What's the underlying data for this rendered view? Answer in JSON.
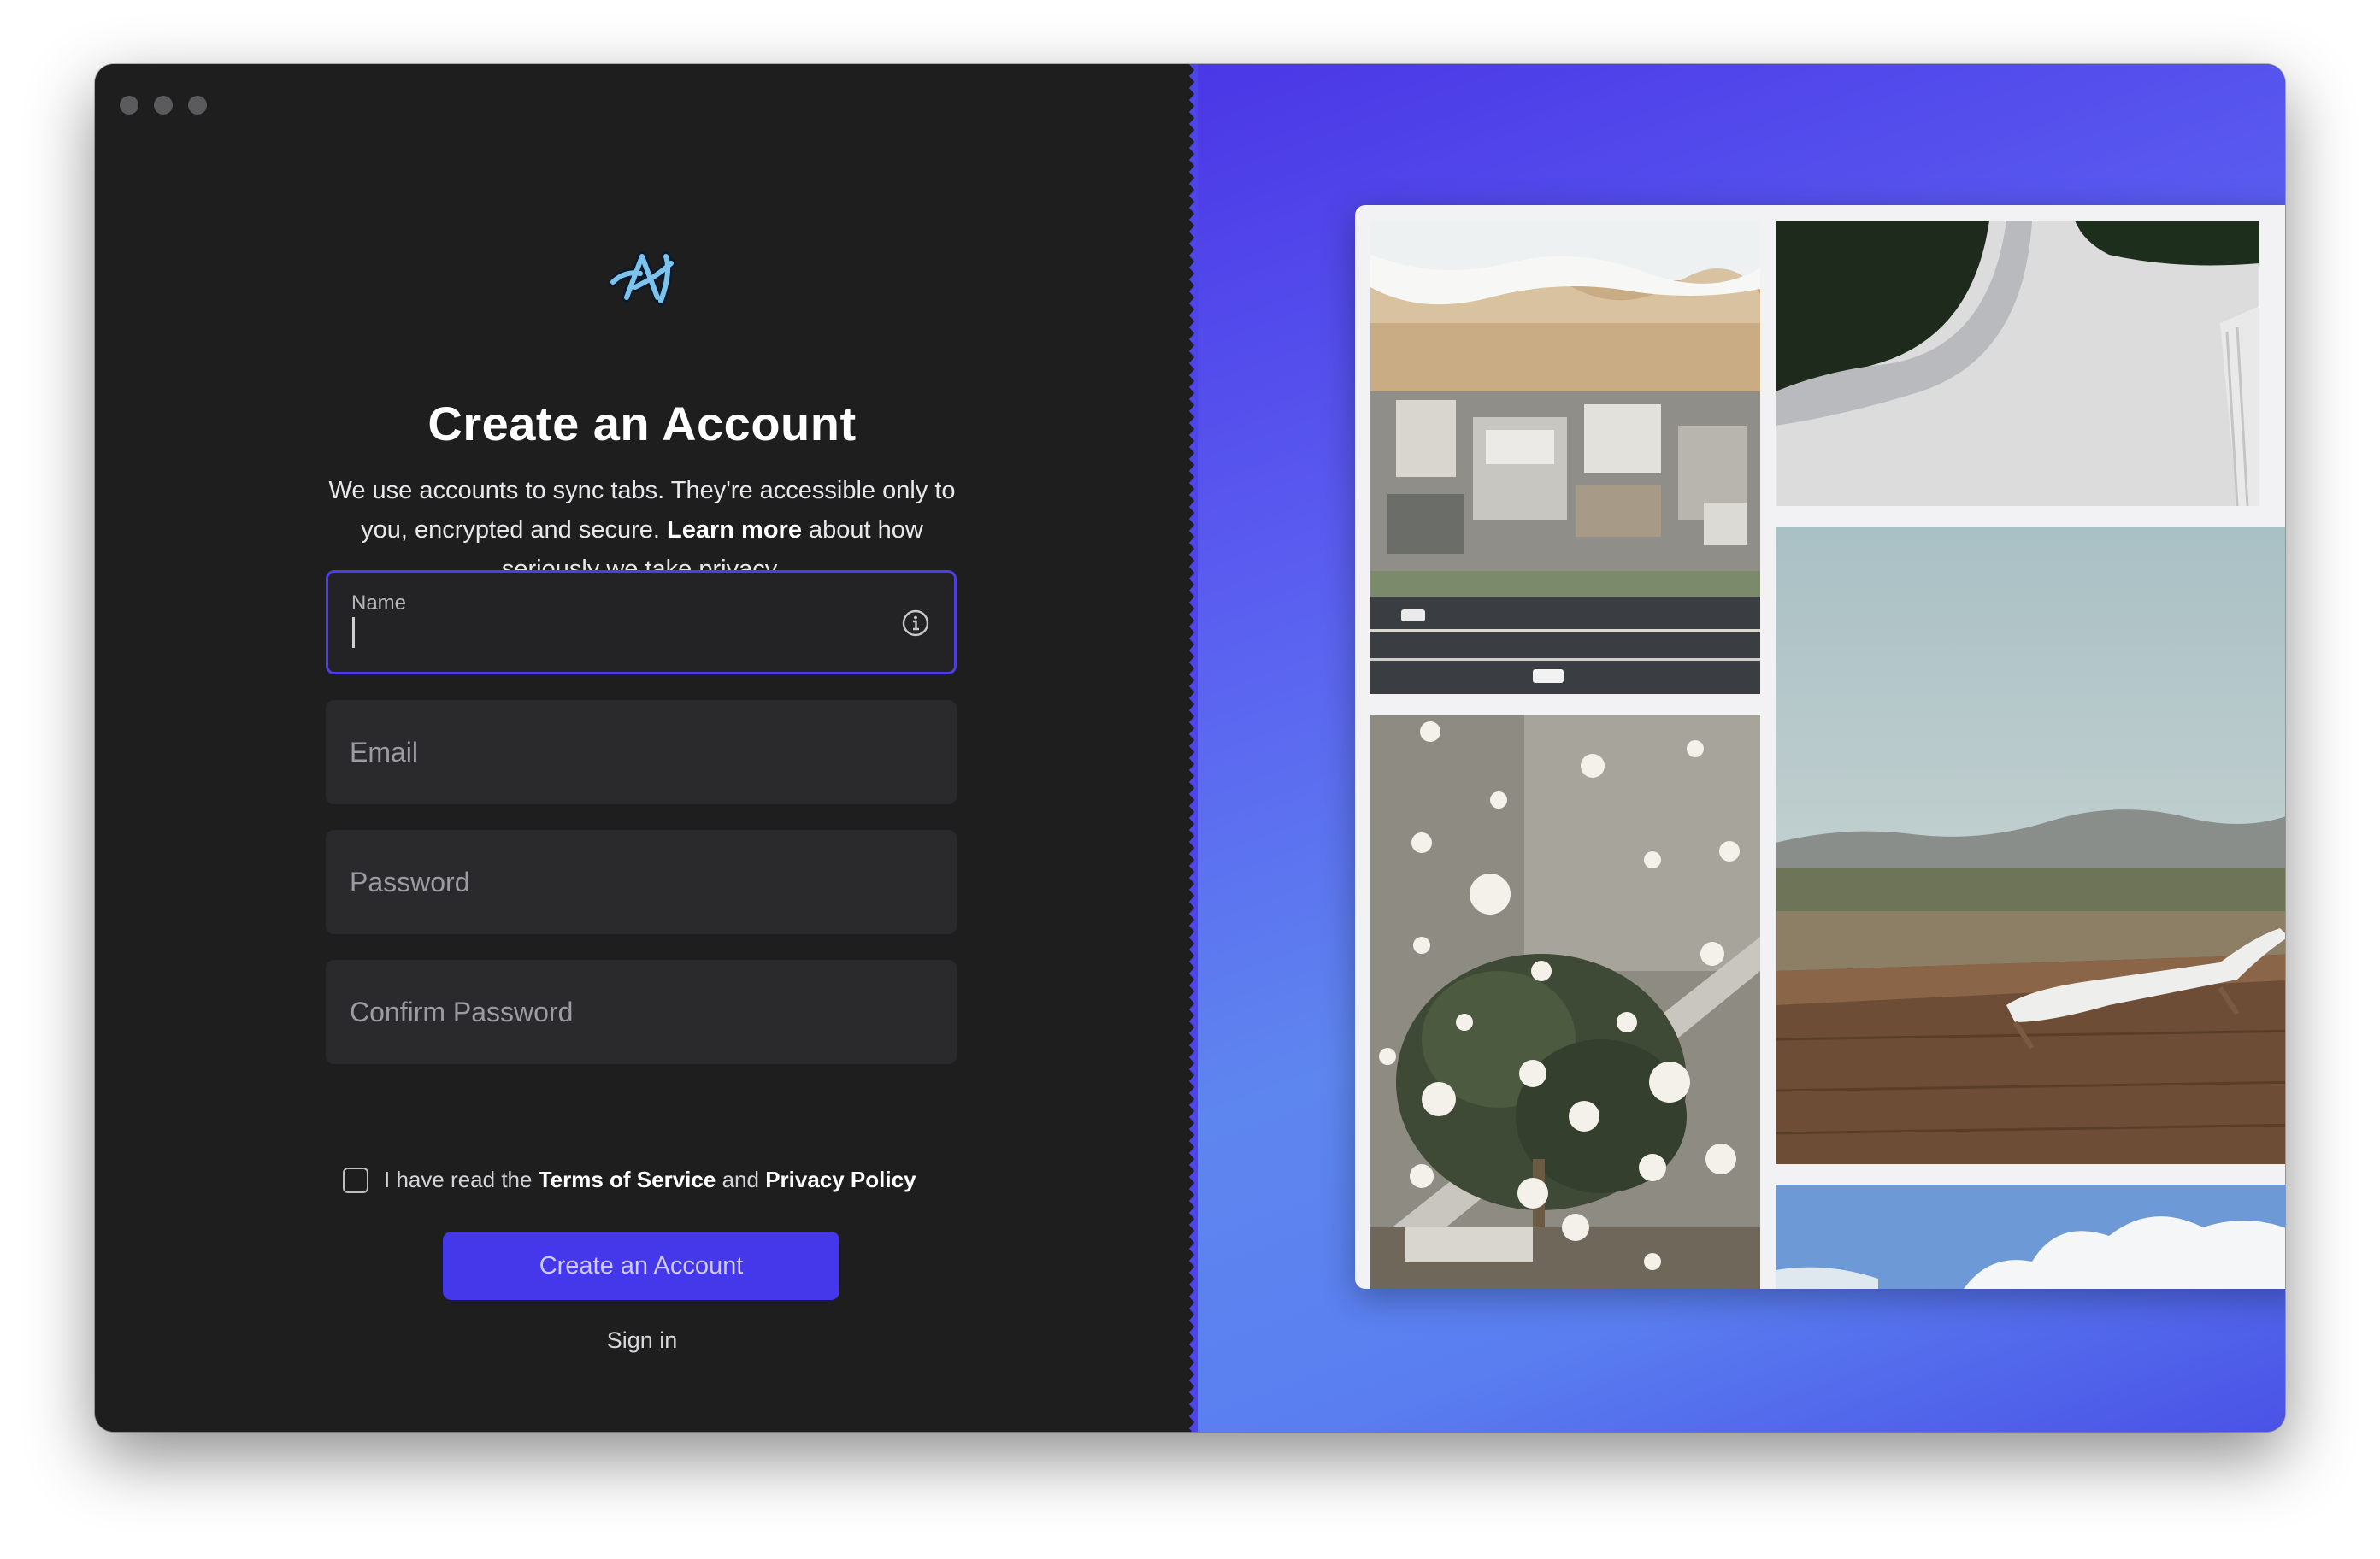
{
  "window": {
    "traffic_lights": [
      "close",
      "minimize",
      "zoom"
    ]
  },
  "brand": {
    "logo_icon": "arc-logo-icon"
  },
  "form": {
    "title": "Create an Account",
    "subtitle_part1": "We use accounts to sync tabs. They're accessible only to you, encrypted and secure.",
    "subtitle_link": "Learn more",
    "subtitle_part2": "about how seriously we take privacy.",
    "name_label": "Name",
    "name_value": "",
    "email_placeholder": "Email",
    "password_placeholder": "Password",
    "confirm_placeholder": "Confirm Password",
    "terms_prefix": "I have read the",
    "terms_link": "Terms of Service",
    "terms_and": "and",
    "privacy_link": "Privacy Policy",
    "terms_checked": false,
    "submit_label": "Create an Account",
    "signin_label": "Sign in"
  },
  "colors": {
    "accent": "#4537ea",
    "left_bg": "#1e1e1f",
    "right_gradient_start": "#4a36e6",
    "right_gradient_end": "#5e86ef"
  },
  "gallery": {
    "tiles": [
      "beach-houses-aerial",
      "snowy-path",
      "hanging-lights-atrium",
      "desert-deck-lounger",
      "sky-clouds"
    ]
  }
}
